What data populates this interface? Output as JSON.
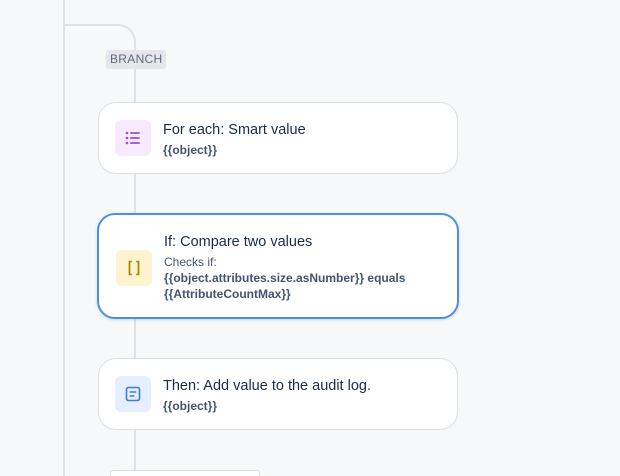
{
  "branch": {
    "label": "BRANCH"
  },
  "steps": [
    {
      "type": "for-each",
      "title": "For each: Smart value",
      "value": "{{object}}",
      "icon": "list-icon",
      "icon_color": "#a24ec7",
      "icon_bg": "#f6eafc"
    },
    {
      "type": "condition",
      "title": "If: Compare two values",
      "meta": "Checks if:",
      "value_line1": "{{object.attributes.size.asNumber}} equals",
      "value_line2": "{{AttributeCountMax}}",
      "icon": "curly-braces-icon",
      "icon_color": "#b38600",
      "icon_bg": "#fdf3cf",
      "selected": true
    },
    {
      "type": "action",
      "title": "Then: Add value to the audit log.",
      "value": "{{object}}",
      "icon": "audit-log-icon",
      "icon_color": "#3d7bd9",
      "icon_bg": "#e6efff"
    }
  ]
}
